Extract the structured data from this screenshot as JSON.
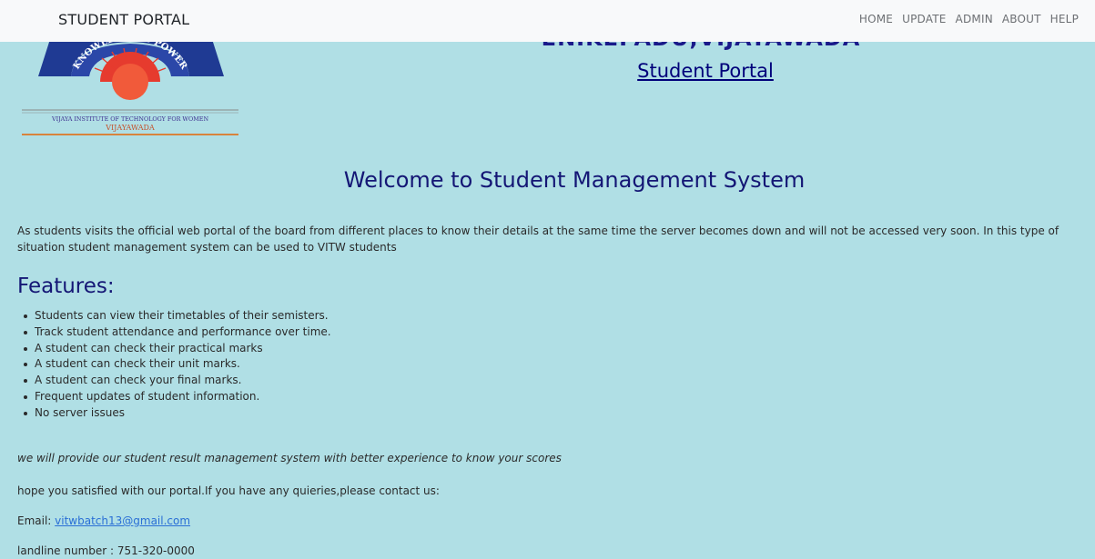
{
  "navbar": {
    "brand": "STUDENT PORTAL",
    "links": [
      "HOME",
      "UPDATE",
      "ADMIN",
      "ABOUT",
      "HELP"
    ]
  },
  "header": {
    "college_line": "ENIKEPADU,VIJAYAWADA",
    "portal_title": "Student Portal"
  },
  "logo": {
    "motto": "KNOWLEDGE IS POWER",
    "institute": "VIJAYA INSTITUTE OF TECHNOLOGY FOR WOMEN",
    "city": "VIJAYAWADA"
  },
  "main": {
    "welcome": "Welcome to Student Management System",
    "intro": "As students visits the official web portal of the board from different places to know their details at the same time the server becomes down and will not be accessed very soon. In this type of situation student management system can be used to VITW students",
    "features_heading": "Features:",
    "features": [
      "Students can view their timetables of their semisters.",
      "Track student attendance and performance over time.",
      "A student can check their practical marks",
      "A student can check their unit marks.",
      "A student can check your final marks.",
      "Frequent updates of student information.",
      "No server issues"
    ],
    "note": "we will provide our student result management system with better experience to know your scores",
    "hope": "hope you satisfied with our portal.If you have any quieries,please contact us:",
    "email_label": "Email: ",
    "email": "vitwbatch13@gmail.com",
    "landline": "landline number : 751-320-0000"
  },
  "colors": {
    "background": "#b0dfe5",
    "navbar": "#f8f9fa",
    "heading": "#141675",
    "link": "#2a6fd6"
  }
}
